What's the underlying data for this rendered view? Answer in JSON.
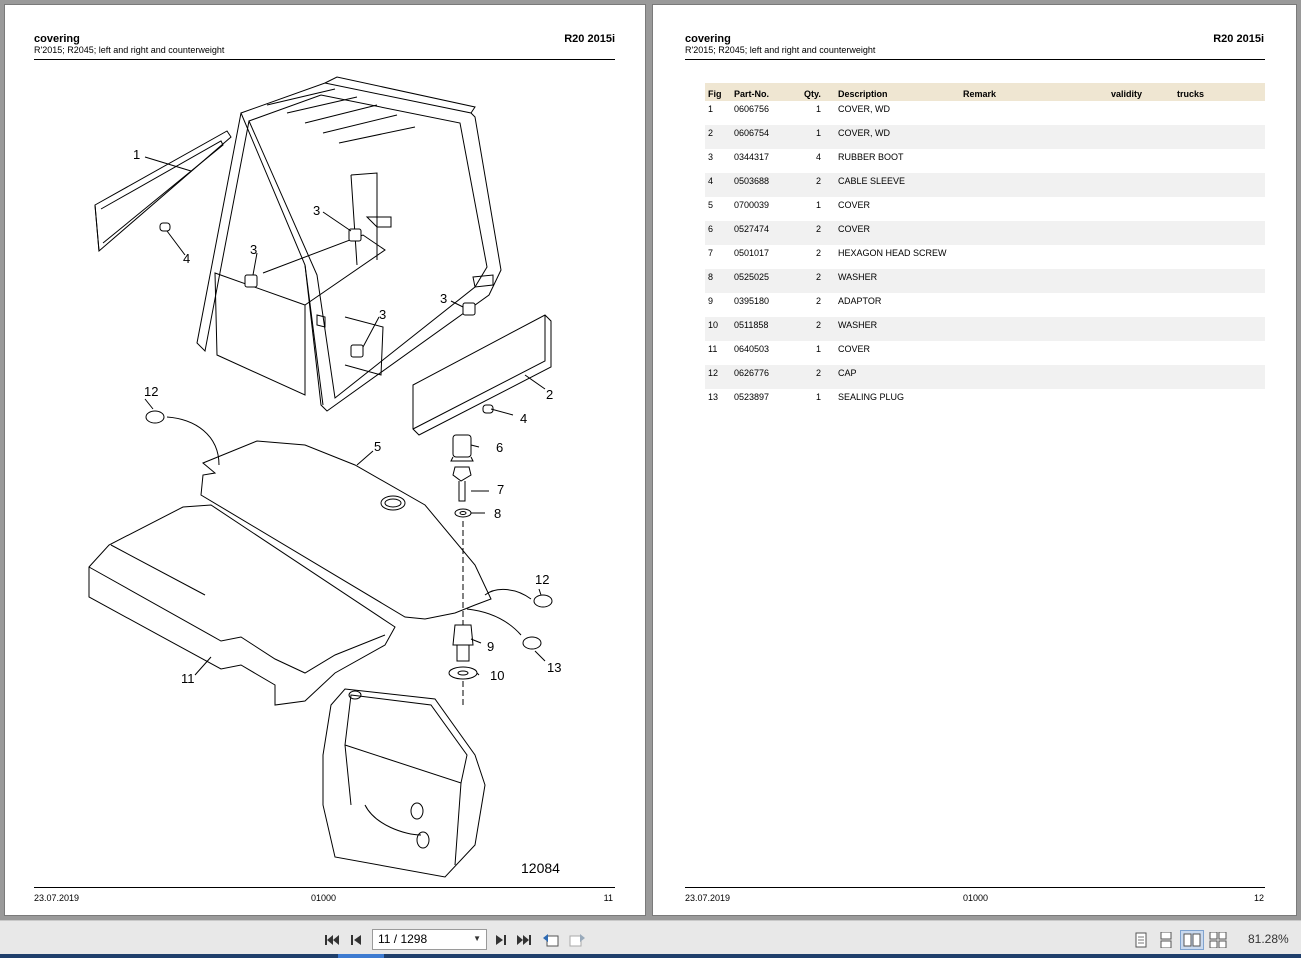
{
  "pages": {
    "left": {
      "title": "covering",
      "subtitle": "R'2015; R2045; left and right and counterweight",
      "model": "R20 2015i",
      "drawing_number": "12084",
      "callouts": [
        "1",
        "2",
        "3",
        "3",
        "3",
        "3",
        "4",
        "4",
        "5",
        "6",
        "7",
        "8",
        "9",
        "10",
        "11",
        "12",
        "12",
        "13"
      ],
      "footer": {
        "date": "23.07.2019",
        "code": "01000",
        "page": "11"
      }
    },
    "right": {
      "title": "covering",
      "subtitle": "R'2015; R2045; left and right and counterweight",
      "model": "R20 2015i",
      "footer": {
        "date": "23.07.2019",
        "code": "01000",
        "page": "12"
      }
    }
  },
  "parts_table": {
    "headers": {
      "fig": "Fig",
      "part_no": "Part-No.",
      "qty": "Qty.",
      "description": "Description",
      "remark": "Remark",
      "validity": "validity",
      "trucks": "trucks"
    },
    "rows": [
      {
        "fig": "1",
        "part_no": "0606756",
        "qty": "1",
        "description": "COVER, WD"
      },
      {
        "fig": "2",
        "part_no": "0606754",
        "qty": "1",
        "description": "COVER, WD"
      },
      {
        "fig": "3",
        "part_no": "0344317",
        "qty": "4",
        "description": "RUBBER BOOT"
      },
      {
        "fig": "4",
        "part_no": "0503688",
        "qty": "2",
        "description": "CABLE SLEEVE"
      },
      {
        "fig": "5",
        "part_no": "0700039",
        "qty": "1",
        "description": "COVER"
      },
      {
        "fig": "6",
        "part_no": "0527474",
        "qty": "2",
        "description": "COVER"
      },
      {
        "fig": "7",
        "part_no": "0501017",
        "qty": "2",
        "description": "HEXAGON HEAD SCREW"
      },
      {
        "fig": "8",
        "part_no": "0525025",
        "qty": "2",
        "description": "WASHER"
      },
      {
        "fig": "9",
        "part_no": "0395180",
        "qty": "2",
        "description": "ADAPTOR"
      },
      {
        "fig": "10",
        "part_no": "0511858",
        "qty": "2",
        "description": "WASHER"
      },
      {
        "fig": "11",
        "part_no": "0640503",
        "qty": "1",
        "description": "COVER"
      },
      {
        "fig": "12",
        "part_no": "0626776",
        "qty": "2",
        "description": "CAP"
      },
      {
        "fig": "13",
        "part_no": "0523897",
        "qty": "1",
        "description": "SEALING PLUG"
      }
    ]
  },
  "toolbar": {
    "page_indicator": "11 / 1298",
    "zoom": "81.28%",
    "icons": [
      "first-page-icon",
      "previous-page-icon",
      "next-page-icon",
      "last-page-icon",
      "go-back-view-icon",
      "go-forward-view-icon",
      "single-page-view-icon",
      "continuous-view-icon",
      "two-page-view-icon",
      "two-page-continuous-view-icon"
    ],
    "active_view": "two-page-view"
  },
  "colors": {
    "background": "#9a9a9a",
    "table_header": "#efe6d2",
    "row_stripe": "#f1f1f1",
    "taskbar": "#1f3f6b",
    "taskbar_active": "#3d7bd1"
  }
}
